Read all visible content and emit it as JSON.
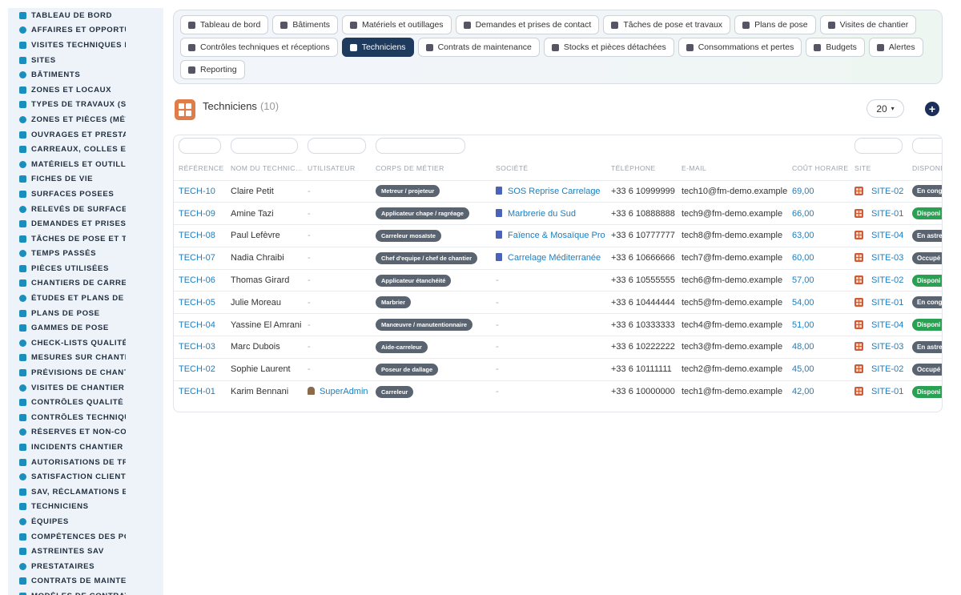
{
  "sidebar": {
    "items": [
      {
        "label": "TABLEAU DE BORD",
        "icon": "gauge-icon"
      },
      {
        "label": "AFFAIRES ET OPPORTUNITÉS",
        "icon": "target-icon"
      },
      {
        "label": "VISITES TECHNIQUES ET",
        "icon": "clipboard-icon"
      },
      {
        "label": "SITES",
        "icon": "map-pin-icon"
      },
      {
        "label": "BÂTIMENTS",
        "icon": "building-icon"
      },
      {
        "label": "ZONES ET LOCAUX",
        "icon": "grid-icon"
      },
      {
        "label": "TYPES DE TRAVAUX (SOL",
        "icon": "sitemap-icon"
      },
      {
        "label": "ZONES ET PIÈCES (MÉTR",
        "icon": "grid-icon"
      },
      {
        "label": "OUVRAGES ET PRESTATI",
        "icon": "plug-icon"
      },
      {
        "label": "CARREAUX, COLLES ET J",
        "icon": "lines-icon"
      },
      {
        "label": "MATÉRIELS ET OUTILLAG",
        "icon": "cogs-icon"
      },
      {
        "label": "FICHES DE VIE",
        "icon": "document-icon"
      },
      {
        "label": "SURFACES POSEES",
        "icon": "history-icon"
      },
      {
        "label": "RELEVÉS DE SURFACES",
        "icon": "list-icon"
      },
      {
        "label": "DEMANDES ET PRISES DI",
        "icon": "question-icon"
      },
      {
        "label": "TÂCHES DE POSE ET TRA",
        "icon": "clipboard-check-icon"
      },
      {
        "label": "TEMPS PASSÉS",
        "icon": "clock-icon"
      },
      {
        "label": "PIÈCES UTILISÉES",
        "icon": "list-icon"
      },
      {
        "label": "CHANTIERS DE CARRELA",
        "icon": "hammer-icon"
      },
      {
        "label": "ÉTUDES ET PLANS DE CA",
        "icon": "file-icon"
      },
      {
        "label": "PLANS DE POSE",
        "icon": "calendar-icon"
      },
      {
        "label": "GAMMES DE POSE",
        "icon": "list-icon"
      },
      {
        "label": "CHECK-LISTS QUALITÉ",
        "icon": "checklist-icon"
      },
      {
        "label": "MESURES SUR CHANTIEF",
        "icon": "ruler-icon"
      },
      {
        "label": "PRÉVISIONS DE CHANTIE",
        "icon": "chart-line-icon"
      },
      {
        "label": "VISITES DE CHANTIER",
        "icon": "walk-icon"
      },
      {
        "label": "CONTRÔLES QUALITÉ",
        "icon": "search-icon"
      },
      {
        "label": "CONTRÔLES TECHNIQUE",
        "icon": "clipboard-icon"
      },
      {
        "label": "RÉSERVES ET NON-CONF",
        "icon": "exclamation-icon"
      },
      {
        "label": "INCIDENTS CHANTIER",
        "icon": "warning-icon"
      },
      {
        "label": "AUTORISATIONS DE TRAV",
        "icon": "file-signature-icon"
      },
      {
        "label": "SATISFACTION CLIENT",
        "icon": "smile-icon"
      },
      {
        "label": "SAV, RÉCLAMATIONS ET",
        "icon": "comments-icon"
      },
      {
        "label": "TECHNICIENS",
        "icon": "helmet-icon"
      },
      {
        "label": "ÉQUIPES",
        "icon": "users-icon"
      },
      {
        "label": "COMPÉTENCES DES POS",
        "icon": "certificate-icon"
      },
      {
        "label": "ASTREINTES SAV",
        "icon": "phone-icon"
      },
      {
        "label": "PRESTATAIRES",
        "icon": "handshake-icon"
      },
      {
        "label": "CONTRATS DE MAINTENA",
        "icon": "file-contract-icon"
      },
      {
        "label": "MODÈLES DE CONTRATS",
        "icon": "copy-icon"
      }
    ]
  },
  "tabs": {
    "row1": [
      {
        "label": "Tableau de bord",
        "icon": "gauge-icon"
      },
      {
        "label": "Bâtiments",
        "icon": "building-icon"
      },
      {
        "label": "Matériels et outillages",
        "icon": "cogs-icon"
      },
      {
        "label": "Demandes et prises de contact",
        "icon": "question-icon"
      },
      {
        "label": "Tâches de pose et travaux",
        "icon": "clipboard-check-icon"
      },
      {
        "label": "Plans de pose",
        "icon": "calendar-icon"
      },
      {
        "label": "Visites de chantier",
        "icon": "walk-icon"
      }
    ],
    "row2": [
      {
        "label": "Contrôles techniques et réceptions",
        "icon": "clipboard-icon"
      },
      {
        "label": "Techniciens",
        "icon": "helmet-icon",
        "active": true
      },
      {
        "label": "Contrats de maintenance",
        "icon": "file-contract-icon"
      },
      {
        "label": "Stocks et pièces détachées",
        "icon": "sitemap-icon"
      },
      {
        "label": "Consommations et pertes",
        "icon": "bolt-icon"
      },
      {
        "label": "Budgets",
        "icon": "money-icon"
      },
      {
        "label": "Alertes",
        "icon": "bell-icon"
      }
    ],
    "row3": [
      {
        "label": "Reporting",
        "icon": "chart-pie-icon"
      }
    ]
  },
  "header": {
    "title": "Techniciens",
    "count": "(10)",
    "per_page": "20"
  },
  "table": {
    "columns": [
      "RÉFÉRENCE",
      "NOM DU TECHNIC…",
      "UTILISATEUR",
      "CORPS DE MÉTIER",
      "SOCIÉTÉ",
      "TÉLÉPHONE",
      "E-MAIL",
      "COÛT HORAIRE",
      "SITE",
      "DISPONI"
    ],
    "rows": [
      {
        "ref": "TECH-10",
        "name": "Claire Petit",
        "user": "-",
        "trade": "Metreur / projeteur",
        "company": "SOS Reprise Carrelage",
        "phone": "+33 6 10999999",
        "email": "tech10@fm-demo.example",
        "cost": "69,00",
        "site": "SITE-02",
        "status": "En cong",
        "status_color": "#5a6470"
      },
      {
        "ref": "TECH-09",
        "name": "Amine Tazi",
        "user": "-",
        "trade": "Applicateur chape / ragréage",
        "company": "Marbrerie du Sud",
        "phone": "+33 6 10888888",
        "email": "tech9@fm-demo.example",
        "cost": "66,00",
        "site": "SITE-01",
        "status": "Disponi",
        "status_color": "#2aa052"
      },
      {
        "ref": "TECH-08",
        "name": "Paul Lefèvre",
        "user": "-",
        "trade": "Carreleur mosaïste",
        "company": "Faïence & Mosaïque Pro",
        "phone": "+33 6 10777777",
        "email": "tech8@fm-demo.example",
        "cost": "63,00",
        "site": "SITE-04",
        "status": "En astre",
        "status_color": "#5a6470"
      },
      {
        "ref": "TECH-07",
        "name": "Nadia Chraibi",
        "user": "-",
        "trade": "Chef d'equipe / chef de chantier",
        "company": "Carrelage Méditerranée",
        "phone": "+33 6 10666666",
        "email": "tech7@fm-demo.example",
        "cost": "60,00",
        "site": "SITE-03",
        "status": "Occupé",
        "status_color": "#5a6470"
      },
      {
        "ref": "TECH-06",
        "name": "Thomas Girard",
        "user": "-",
        "trade": "Applicateur étanchéité",
        "company": "-",
        "phone": "+33 6 10555555",
        "email": "tech6@fm-demo.example",
        "cost": "57,00",
        "site": "SITE-02",
        "status": "Disponi",
        "status_color": "#2aa052"
      },
      {
        "ref": "TECH-05",
        "name": "Julie Moreau",
        "user": "-",
        "trade": "Marbrier",
        "company": "-",
        "phone": "+33 6 10444444",
        "email": "tech5@fm-demo.example",
        "cost": "54,00",
        "site": "SITE-01",
        "status": "En cong",
        "status_color": "#5a6470"
      },
      {
        "ref": "TECH-04",
        "name": "Yassine El Amrani",
        "user": "-",
        "trade": "Manœuvre / manutentionnaire",
        "company": "-",
        "phone": "+33 6 10333333",
        "email": "tech4@fm-demo.example",
        "cost": "51,00",
        "site": "SITE-04",
        "status": "Disponi",
        "status_color": "#2aa052"
      },
      {
        "ref": "TECH-03",
        "name": "Marc Dubois",
        "user": "-",
        "trade": "Aide-carreleur",
        "company": "-",
        "phone": "+33 6 10222222",
        "email": "tech3@fm-demo.example",
        "cost": "48,00",
        "site": "SITE-03",
        "status": "En astre",
        "status_color": "#5a6470"
      },
      {
        "ref": "TECH-02",
        "name": "Sophie Laurent",
        "user": "-",
        "trade": "Poseur de dallage",
        "company": "-",
        "phone": "+33 6 10111111",
        "email": "tech2@fm-demo.example",
        "cost": "45,00",
        "site": "SITE-02",
        "status": "Occupé",
        "status_color": "#5a6470"
      },
      {
        "ref": "TECH-01",
        "name": "Karim Bennani",
        "user": "SuperAdmin",
        "trade": "Carreleur",
        "company": "-",
        "phone": "+33 6 10000000",
        "email": "tech1@fm-demo.example",
        "cost": "42,00",
        "site": "SITE-01",
        "status": "Disponi",
        "status_color": "#2aa052"
      }
    ]
  }
}
